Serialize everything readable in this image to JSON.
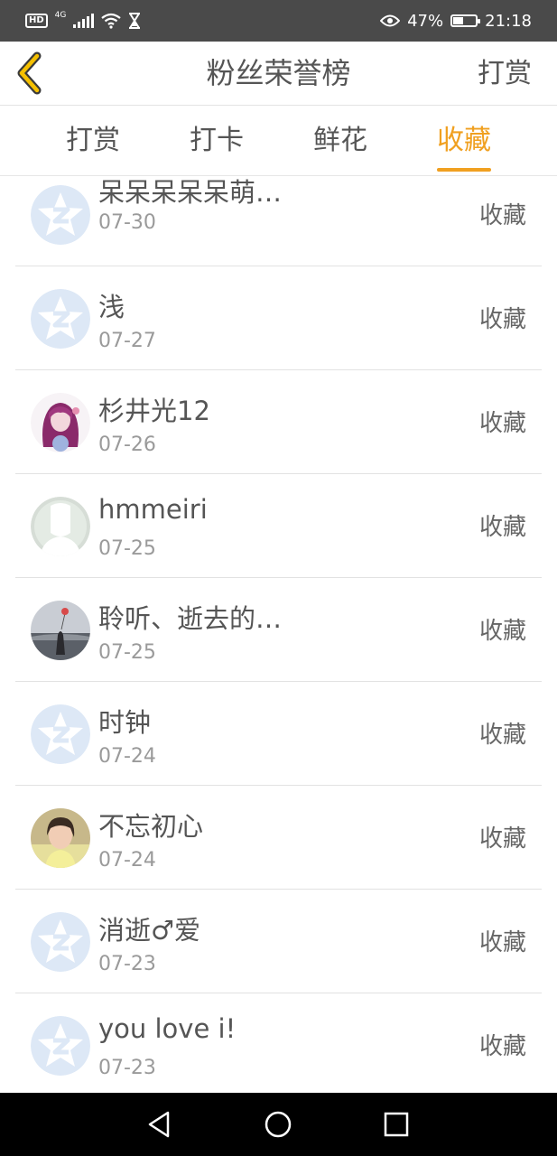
{
  "status_bar": {
    "hd": "HD",
    "network": "4G",
    "battery_percent": "47%",
    "battery_level": 0.47,
    "time": "21:18",
    "icons": [
      "hd-icon",
      "signal-icon",
      "wifi-icon",
      "hourglass-icon",
      "eye-icon",
      "battery-icon"
    ]
  },
  "header": {
    "title": "粉丝荣誉榜",
    "action_label": "打赏",
    "back_icon": "chevron-left-icon",
    "accent_color": "#f0a020"
  },
  "tabs": [
    {
      "label": "打赏",
      "active": false
    },
    {
      "label": "打卡",
      "active": false
    },
    {
      "label": "鲜花",
      "active": false
    },
    {
      "label": "收藏",
      "active": true
    }
  ],
  "list": [
    {
      "name": "呆呆呆呆呆萌…",
      "date": "07-30",
      "action": "收藏",
      "avatar": "default-star-avatar"
    },
    {
      "name": "浅",
      "date": "07-27",
      "action": "收藏",
      "avatar": "default-star-avatar"
    },
    {
      "name": "杉井光12",
      "date": "07-26",
      "action": "收藏",
      "avatar": "anime-girl-avatar"
    },
    {
      "name": "hmmeiri",
      "date": "07-25",
      "action": "收藏",
      "avatar": "silhouette-avatar"
    },
    {
      "name": "聆听、逝去的…",
      "date": "07-25",
      "action": "收藏",
      "avatar": "balloon-photo-avatar"
    },
    {
      "name": "时钟",
      "date": "07-24",
      "action": "收藏",
      "avatar": "default-star-avatar"
    },
    {
      "name": "不忘初心",
      "date": "07-24",
      "action": "收藏",
      "avatar": "girl-photo-avatar"
    },
    {
      "name": "消逝♂爱",
      "date": "07-23",
      "action": "收藏",
      "avatar": "default-star-avatar"
    },
    {
      "name": "you love i!",
      "date": "07-23",
      "action": "收藏",
      "avatar": "default-star-avatar"
    }
  ],
  "nav_bar": {
    "buttons": [
      "back-triangle-icon",
      "home-circle-icon",
      "recents-square-icon"
    ]
  }
}
